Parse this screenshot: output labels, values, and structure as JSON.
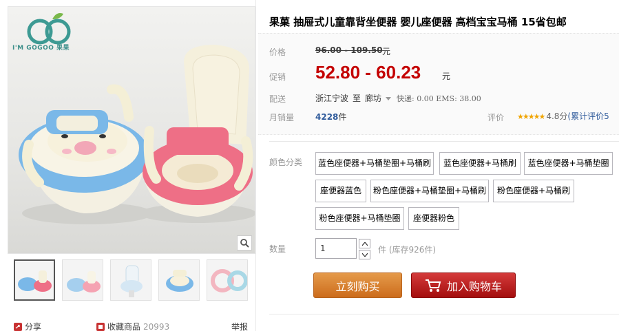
{
  "gallery": {
    "brand_text": "I'M GOGOO 果果",
    "zoom_icon": "magnifier-icon",
    "thumbnails": 5
  },
  "product": {
    "title": "果菓 抽屉式儿童靠背坐便器 婴儿座便器 高档宝宝马桶 15省包邮",
    "price_label": "价格",
    "original_price": "96.00 - 109.50",
    "original_unit": "元",
    "promo_label": "促销",
    "promo_price": "52.80 - 60.23",
    "promo_unit": "元",
    "ship_label": "配送",
    "ship_from": "浙江宁波",
    "ship_to_word": "至",
    "ship_to": "廊坊",
    "ship_fee": "快递: 0.00 EMS: 38.00",
    "sales_label": "月销量",
    "sales_count": "4228",
    "sales_unit": "件",
    "rating_label": "评价",
    "rating_stars": "★★★★★",
    "rating_score": "4.8分",
    "rating_link": "(累计评价5"
  },
  "sku": {
    "label": "颜色分类",
    "options": [
      "蓝色座便器+马桶垫圈+马桶刷",
      "蓝色座便器+马桶刷",
      "蓝色座便器+马桶垫圈",
      "座便器蓝色",
      "粉色座便器+马桶垫圈+马桶刷",
      "粉色座便器+马桶刷",
      "粉色座便器+马桶垫圈",
      "座便器粉色"
    ]
  },
  "quantity": {
    "label": "数量",
    "value": "1",
    "unit": "件",
    "stock": "(库存926件)"
  },
  "actions": {
    "buy_now": "立刻购买",
    "add_to_cart": "加入购物车"
  },
  "footer": {
    "share": "分享",
    "favorite": "收藏商品",
    "favorite_count": "20993",
    "report": "举报"
  },
  "colors": {
    "price_red": "#c40000",
    "buy_orange": "#cc6c1c",
    "cart_red": "#a40e0e",
    "link_blue": "#315c9c",
    "star_gold": "#f0a400"
  }
}
